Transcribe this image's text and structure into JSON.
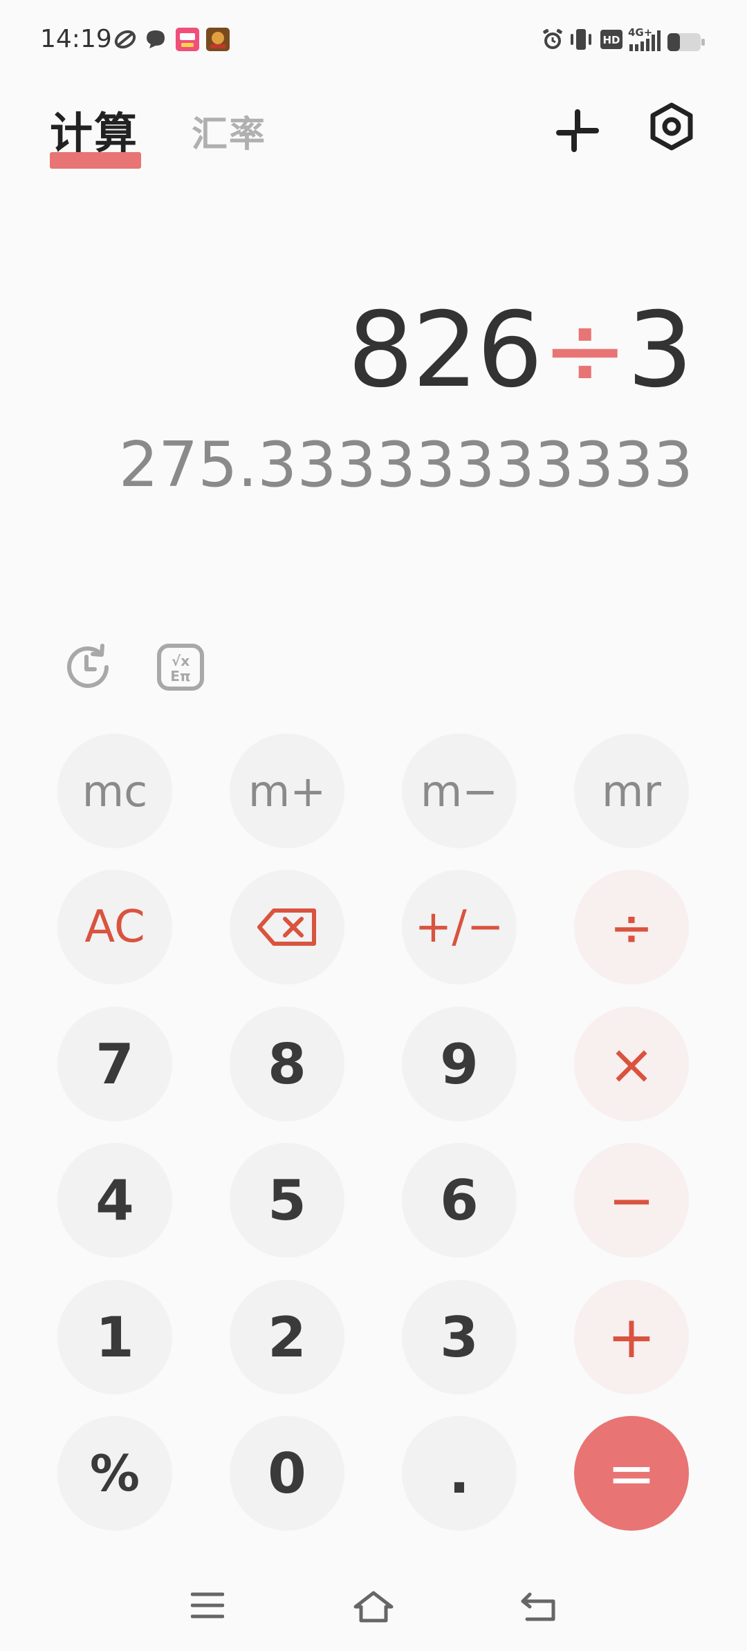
{
  "status_bar": {
    "time": "14:19",
    "network": "4G+"
  },
  "tabs": [
    {
      "label": "计算",
      "active": true
    },
    {
      "label": "汇率",
      "active": false
    }
  ],
  "toolbar_icons": [
    "collapse-icon",
    "settings-icon"
  ],
  "display": {
    "operand1": "826",
    "operator": "÷",
    "operand2": "3",
    "result": "275.33333333333"
  },
  "tools": [
    "history-icon",
    "scientific-icon"
  ],
  "keys": {
    "mc": "mc",
    "mplus": "m+",
    "mminus": "m−",
    "mr": "mr",
    "ac": "AC",
    "sign": "+/−",
    "divide": "÷",
    "seven": "7",
    "eight": "8",
    "nine": "9",
    "multiply": "×",
    "four": "4",
    "five": "5",
    "six": "6",
    "minus": "−",
    "one": "1",
    "two": "2",
    "three": "3",
    "plus": "+",
    "percent": "%",
    "zero": "0",
    "dot": ".",
    "equals": "="
  },
  "colors": {
    "accent": "#e87474",
    "operator_text": "#d9533f",
    "key_bg": "#f2f2f2",
    "operator_key_bg": "#f8efef"
  }
}
